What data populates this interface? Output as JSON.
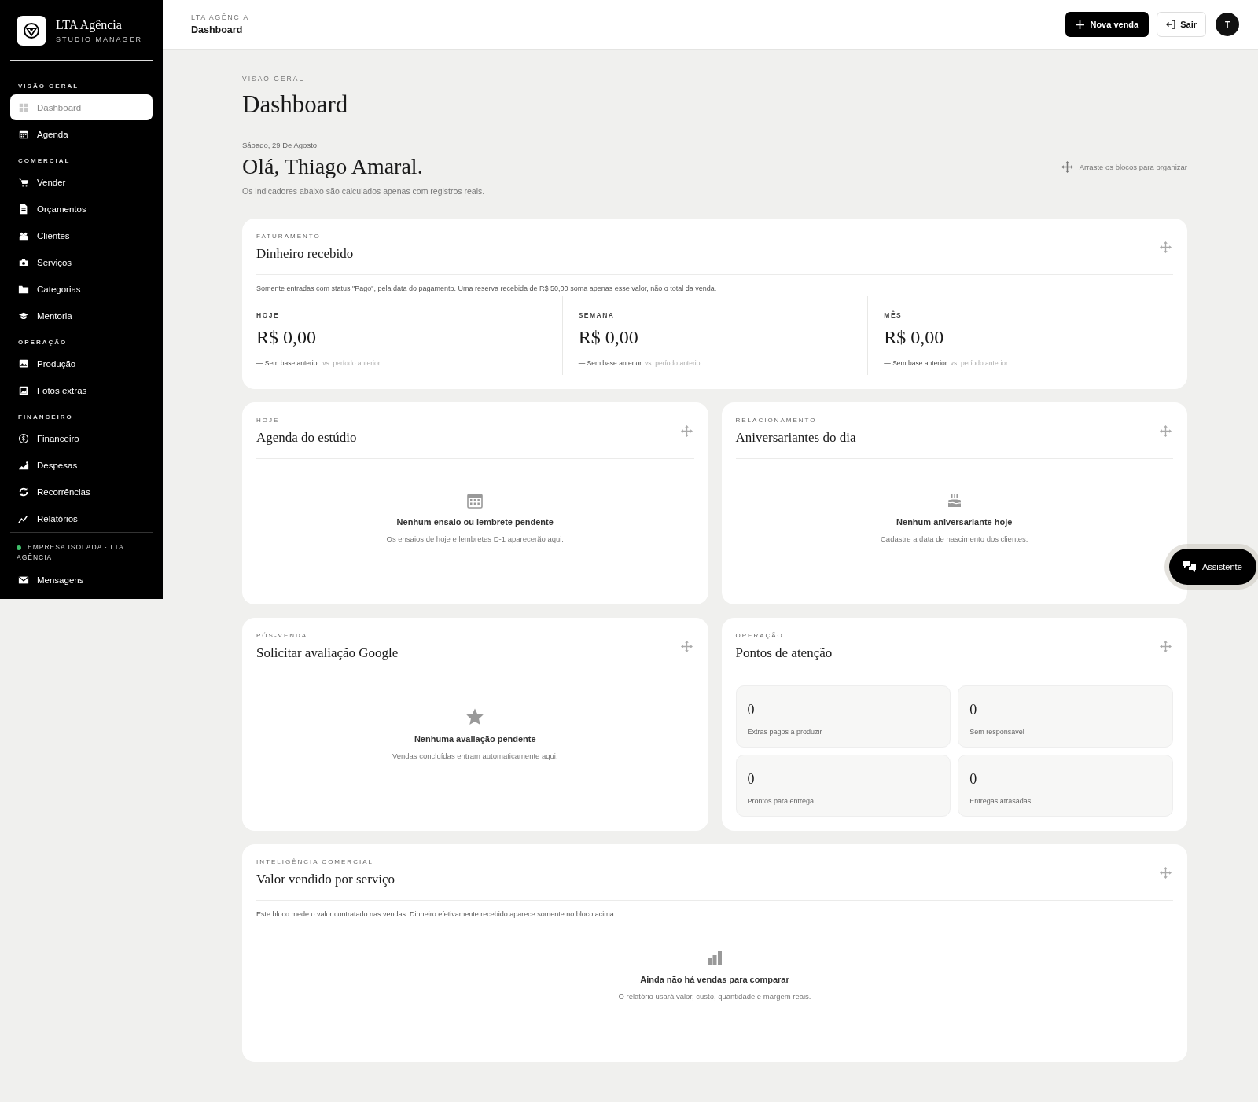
{
  "sidebar": {
    "brand": {
      "name": "LTA Agência",
      "subtitle": "STUDIO MANAGER"
    },
    "sections": [
      {
        "title": "VISÃO GERAL",
        "items": [
          {
            "label": "Dashboard",
            "selected": true
          },
          {
            "label": "Agenda",
            "selected": false
          }
        ]
      },
      {
        "title": "COMERCIAL",
        "items": [
          {
            "label": "Vender",
            "selected": false
          },
          {
            "label": "Orçamentos",
            "selected": false
          },
          {
            "label": "Clientes",
            "selected": false
          },
          {
            "label": "Serviços",
            "selected": false
          },
          {
            "label": "Categorias",
            "selected": false
          },
          {
            "label": "Mentoria",
            "selected": false
          }
        ]
      },
      {
        "title": "OPERAÇÃO",
        "items": [
          {
            "label": "Produção",
            "selected": false
          },
          {
            "label": "Fotos extras",
            "selected": false
          }
        ]
      },
      {
        "title": "FINANCEIRO",
        "items": [
          {
            "label": "Financeiro",
            "selected": false
          },
          {
            "label": "Despesas",
            "selected": false
          },
          {
            "label": "Recorrências",
            "selected": false
          },
          {
            "label": "Relatórios",
            "selected": false
          }
        ]
      }
    ],
    "footer": {
      "status": "EMPRESA ISOLADA · LTA AGÊNCIA",
      "color": "#3fbf6a"
    },
    "extra_item": {
      "label": "Mensagens",
      "selected": false
    }
  },
  "header": {
    "breadcrumb": "LTA AGÊNCIA",
    "title": "Dashboard",
    "new_sale": "Nova venda",
    "logout": "Sair",
    "avatar": "T"
  },
  "page": {
    "eyebrow": "VISÃO GERAL",
    "title": "Dashboard",
    "date": "Sábado, 29 De Agosto",
    "greeting": "Olá, Thiago Amaral.",
    "subtitle": "Os indicadores abaixo são calculados apenas com registros reais.",
    "drag_hint": "Arraste os blocos para organizar"
  },
  "cards": [
    {
      "kind": "revenue",
      "wide": true,
      "eyebrow": "FATURAMENTO",
      "title": "Dinheiro recebido",
      "note": "Somente entradas com status \"Pago\", pela data do pagamento. Uma reserva recebida de R$ 50,00 soma apenas esse valor, não o total da venda.",
      "metrics": [
        {
          "label": "HOJE",
          "value": "R$ 0,00",
          "delta": "— Sem base anterior",
          "comparison": "vs. período anterior"
        },
        {
          "label": "SEMANA",
          "value": "R$ 0,00",
          "delta": "— Sem base anterior",
          "comparison": "vs. período anterior"
        },
        {
          "label": "MÊS",
          "value": "R$ 0,00",
          "delta": "— Sem base anterior",
          "comparison": "vs. período anterior"
        }
      ]
    },
    {
      "kind": "empty",
      "wide": false,
      "eyebrow": "HOJE",
      "title": "Agenda do estúdio",
      "empty_title": "Nenhum ensaio ou lembrete pendente",
      "empty_text": "Os ensaios de hoje e lembretes D-1 aparecerão aqui."
    },
    {
      "kind": "empty",
      "wide": false,
      "eyebrow": "RELACIONAMENTO",
      "title": "Aniversariantes do dia",
      "empty_title": "Nenhum aniversariante hoje",
      "empty_text": "Cadastre a data de nascimento dos clientes."
    },
    {
      "kind": "empty",
      "wide": false,
      "eyebrow": "PÓS-VENDA",
      "title": "Solicitar avaliação Google",
      "empty_title": "Nenhuma avaliação pendente",
      "empty_text": "Vendas concluídas entram automaticamente aqui."
    },
    {
      "kind": "attention",
      "wide": false,
      "eyebrow": "OPERAÇÃO",
      "title": "Pontos de atenção",
      "items": [
        {
          "value": "0",
          "label": "Extras pagos a produzir"
        },
        {
          "value": "0",
          "label": "Sem responsável"
        },
        {
          "value": "0",
          "label": "Prontos para entrega"
        },
        {
          "value": "0",
          "label": "Entregas atrasadas"
        }
      ]
    },
    {
      "kind": "empty",
      "wide": true,
      "eyebrow": "INTELIGÊNCIA COMERCIAL",
      "title": "Valor vendido por serviço",
      "note": "Este bloco mede o valor contratado nas vendas. Dinheiro efetivamente recebido aparece somente no bloco acima.",
      "empty_title": "Ainda não há vendas para comparar",
      "empty_text": "O relatório usará valor, custo, quantidade e margem reais."
    }
  ],
  "assistant": {
    "label": "Assistente"
  }
}
